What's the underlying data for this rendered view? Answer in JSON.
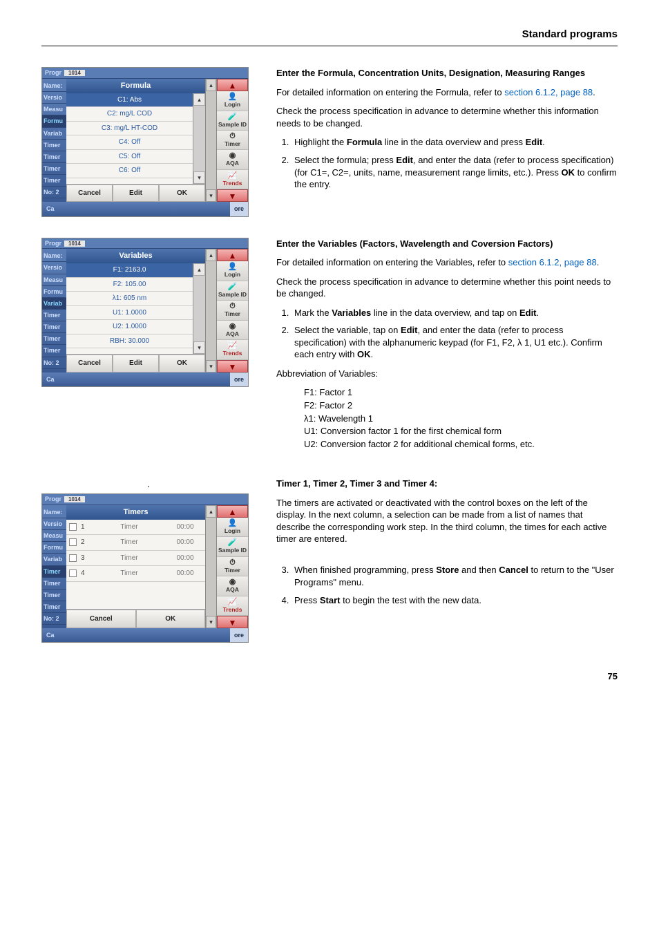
{
  "header": {
    "section_title": "Standard programs"
  },
  "sidebar_labels": [
    "Name:",
    "Versio",
    "Measu",
    "Formu",
    "Variab",
    "Timer",
    "Timer",
    "Timer",
    "Timer",
    "No: 2"
  ],
  "right_panel": {
    "login": "Login",
    "sample_id": "Sample ID",
    "timer": "Timer",
    "aqa": "AQA",
    "trends": "Trends"
  },
  "prog_header": {
    "prefix": "Progr",
    "num": "1014"
  },
  "popup_buttons": {
    "cancel": "Cancel",
    "edit": "Edit",
    "ok": "OK"
  },
  "popup_buttons2": {
    "cancel": "Cancel",
    "ok": "OK"
  },
  "footer": {
    "ca": "Ca",
    "ore": "ore"
  },
  "shot1": {
    "title": "Formula",
    "items": [
      "C1:  Abs",
      "C2: mg/L COD",
      "C3: mg/L HT-COD",
      "C4: Off",
      "C5: Off",
      "C6: Off"
    ]
  },
  "shot2": {
    "title": "Variables",
    "items": [
      "F1: 2163.0",
      "F2: 105.00",
      "λ1: 605 nm",
      "U1: 1.0000",
      "U2: 1.0000",
      "RBH: 30.000"
    ]
  },
  "shot3": {
    "title": "Timers",
    "rows": [
      {
        "n": "1",
        "label": "Timer",
        "val": "00:00"
      },
      {
        "n": "2",
        "label": "Timer",
        "val": "00:00"
      },
      {
        "n": "3",
        "label": "Timer",
        "val": "00:00"
      },
      {
        "n": "4",
        "label": "Timer",
        "val": "00:00"
      }
    ]
  },
  "section1": {
    "heading": "Enter the Formula, Concentration Units, Designation, Measuring Ranges",
    "p1a": "For detailed information on entering the Formula, refer to ",
    "p1_link": "section 6.1.2, page 88",
    "p2": "Check the process specification in advance to determine whether this information needs to be changed.",
    "li1a": "Highlight the ",
    "li1b": "Formula",
    "li1c": " line in the data overview and press ",
    "li1d": "Edit",
    "li2a": "Select the formula; press ",
    "li2b": "Edit",
    "li2c": ", and enter the data (refer to process specification) (for C1=, C2=, units, name, measurement range limits, etc.). Press ",
    "li2d": "OK",
    "li2e": " to confirm the entry."
  },
  "section2": {
    "heading": "Enter the Variables (Factors, Wavelength and Coversion Factors)",
    "p1a": "For detailed information on entering the Variables, refer to ",
    "p1_link": "section 6.1.2, page 88",
    "p2": "Check the process specification in advance to determine whether this point needs to be changed.",
    "li1a": "Mark the ",
    "li1b": "Variables",
    "li1c": " line in the data overview, and tap on ",
    "li1d": "Edit",
    "li2a": "Select the variable, tap on ",
    "li2b": "Edit",
    "li2c": ", and enter the data (refer to process specification) with the alphanumeric keypad (for F1, F2, λ 1, U1 etc.). Confirm each entry with ",
    "li2d": "OK",
    "abbrev_head": "Abbreviation of Variables:",
    "abbrevs": [
      "F1: Factor 1",
      "F2: Factor 2",
      "λ1: Wavelength 1",
      "U1: Conversion factor 1 for the first chemical form",
      "U2: Conversion factor 2 for additional chemical forms, etc."
    ]
  },
  "section3": {
    "heading": "Timer 1, Timer 2, Timer 3 and Timer 4:",
    "p1": "The timers are activated or deactivated with the control boxes on the left of the display. In the next column, a selection can be made from a list of names that describe the corresponding work step. In the third column, the times for each active timer are entered.",
    "li3a": "When finished programming, press ",
    "li3b": "Store",
    "li3c": " and then ",
    "li3d": "Cancel",
    "li3e": " to return to the \"User Programs\" menu.",
    "li4a": "Press ",
    "li4b": "Start",
    "li4c": " to begin the test with the new data."
  },
  "page_number": "75"
}
